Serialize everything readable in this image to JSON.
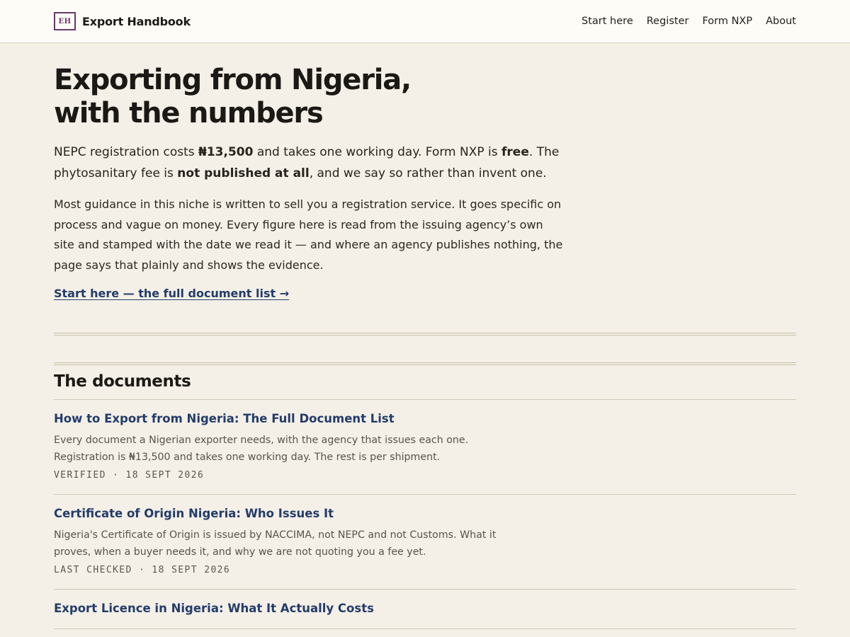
{
  "header": {
    "brand_mark": "EH",
    "brand_name": "Export Handbook",
    "nav": [
      "Start here",
      "Register",
      "Form NXP",
      "About"
    ]
  },
  "hero": {
    "title": "Exporting from Nigeria, with the numbers",
    "lede": {
      "p1": "NEPC registration costs ",
      "b1": "₦13,500",
      "p2": " and takes one working day. Form NXP is ",
      "b2": "free",
      "p3": ". The phytosanitary fee is ",
      "b3": "not published at all",
      "p4": ", and we say so rather than invent one."
    },
    "body": "Most guidance in this niche is written to sell you a registration service. It goes specific on process and vague on money. Every figure here is read from the issuing agency’s own site and stamped with the date we read it — and where an agency publishes nothing, the page says that plainly and shows the evidence.",
    "cta": "Start here — the full document list →"
  },
  "documents": {
    "heading": "The documents",
    "items": [
      {
        "title": "How to Export from Nigeria: The Full Document List",
        "desc": "Every document a Nigerian exporter needs, with the agency that issues each one. Registration is ₦13,500 and takes one working day. The rest is per shipment.",
        "meta": "VERIFIED · 18 SEPT 2026"
      },
      {
        "title": "Certificate of Origin Nigeria: Who Issues It",
        "desc": "Nigeria's Certificate of Origin is issued by NACCIMA, not NEPC and not Customs. What it proves, when a buyer needs it, and why we are not quoting you a fee yet.",
        "meta": "LAST CHECKED · 18 SEPT 2026"
      },
      {
        "title": "Export Licence in Nigeria: What It Actually Costs",
        "desc": "",
        "meta": ""
      }
    ]
  }
}
